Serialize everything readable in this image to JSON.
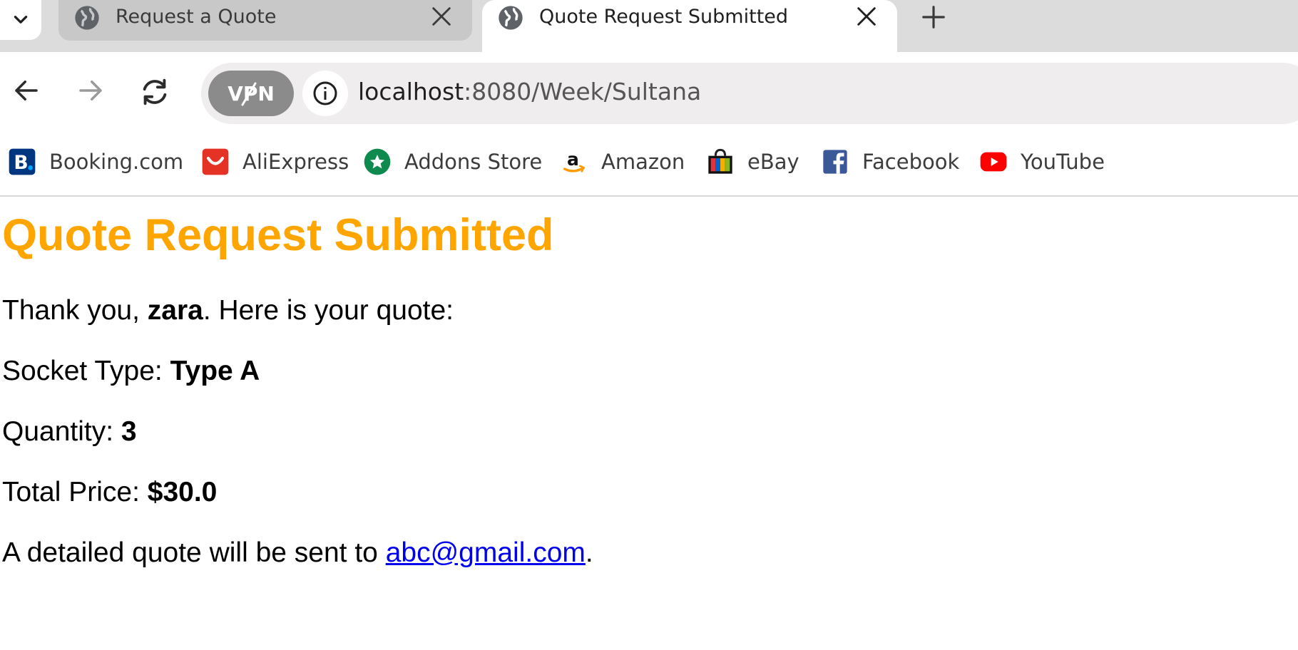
{
  "tabs": [
    {
      "title": "Request a Quote",
      "active": false
    },
    {
      "title": "Quote Request Submitted",
      "active": true
    }
  ],
  "address_bar": {
    "vpn_label": "VPN",
    "url_host": "localhost",
    "url_path": ":8080/Week/Sultana"
  },
  "bookmarks": [
    {
      "label": "Booking.com",
      "icon": "booking-icon"
    },
    {
      "label": "AliExpress",
      "icon": "aliexpress-icon"
    },
    {
      "label": "Addons Store",
      "icon": "addons-store-icon"
    },
    {
      "label": "Amazon",
      "icon": "amazon-icon"
    },
    {
      "label": "eBay",
      "icon": "ebay-icon"
    },
    {
      "label": "Facebook",
      "icon": "facebook-icon"
    },
    {
      "label": "YouTube",
      "icon": "youtube-icon"
    }
  ],
  "page": {
    "heading": "Quote Request Submitted",
    "thanks_prefix": "Thank you, ",
    "customer_name": "zara",
    "thanks_suffix": ". Here is your quote:",
    "socket_type_label": "Socket Type: ",
    "socket_type_value": "Type A",
    "quantity_label": "Quantity: ",
    "quantity_value": "3",
    "total_price_label": "Total Price: ",
    "total_price_value": "$30.0",
    "email_prefix": "A detailed quote will be sent to ",
    "email": "abc@gmail.com",
    "email_suffix": "."
  },
  "colors": {
    "heading": "#ffa500",
    "link": "#0000ee",
    "tabstrip": "#dcdcdc",
    "omnibox": "#efeded"
  }
}
